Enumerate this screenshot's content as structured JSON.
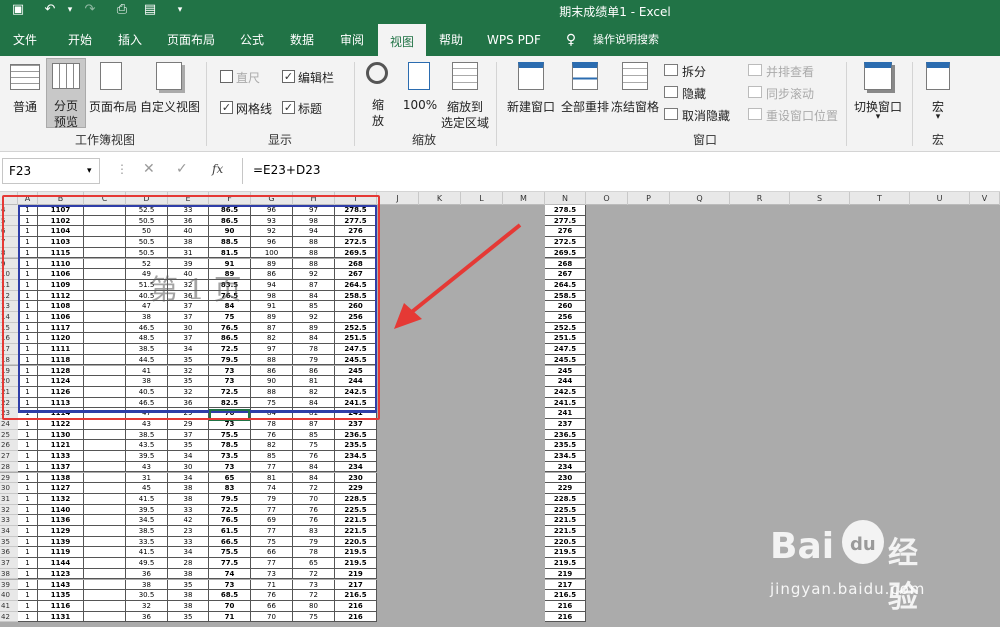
{
  "title": "期末成绩单1  -  Excel",
  "tabs": [
    "文件",
    "开始",
    "插入",
    "页面布局",
    "公式",
    "数据",
    "审阅",
    "视图",
    "帮助",
    "WPS PDF",
    "操作说明搜索"
  ],
  "active_tab": "视图",
  "ribbon": {
    "normal": "普通",
    "pagebreak1": "分页",
    "pagebreak2": "预览",
    "pagelayout": "页面布局",
    "customview": "自定义视图",
    "workbook_group": "工作簿视图",
    "ruler": "直尺",
    "formula_bar": "编辑栏",
    "gridlines": "网格线",
    "headings": "标题",
    "show_group": "显示",
    "zoom": "缩",
    "zoom2": "放",
    "zoom100": "100%",
    "zoomsel1": "缩放到",
    "zoomsel2": "选定区域",
    "zoom_group": "缩放",
    "newwin": "新建窗口",
    "arrange": "全部重排",
    "freeze": "冻结窗格",
    "split": "拆分",
    "hide": "隐藏",
    "unhide": "取消隐藏",
    "side": "并排查看",
    "sync": "同步滚动",
    "reset": "重设窗口位置",
    "window_group": "窗口",
    "switch": "切换窗口",
    "macro": "宏",
    "macro_group": "宏"
  },
  "namebox": "F23",
  "fx": "fx",
  "formula": "=E23+D23",
  "columns": [
    "A",
    "B",
    "C",
    "D",
    "E",
    "F",
    "G",
    "H",
    "I",
    "J",
    "K",
    "L",
    "M",
    "N",
    "O",
    "P",
    "Q",
    "R",
    "S",
    "T",
    "U",
    "V"
  ],
  "page_label": "第 1 页",
  "watermark": {
    "brand": "Bai",
    "paw": "du",
    "cn": "经验",
    "url": "jingyan.baidu.com"
  },
  "rows": [
    [
      "4",
      "1",
      "1107",
      "",
      "52.5",
      "33",
      "86.5",
      "96",
      "97",
      "278.5",
      "278.5"
    ],
    [
      "5",
      "1",
      "1102",
      "",
      "50.5",
      "36",
      "86.5",
      "93",
      "98",
      "277.5",
      "277.5"
    ],
    [
      "6",
      "1",
      "1104",
      "",
      "50",
      "40",
      "90",
      "92",
      "94",
      "276",
      "276"
    ],
    [
      "7",
      "1",
      "1103",
      "",
      "50.5",
      "38",
      "88.5",
      "96",
      "88",
      "272.5",
      "272.5"
    ],
    [
      "8",
      "1",
      "1115",
      "",
      "50.5",
      "31",
      "81.5",
      "100",
      "88",
      "269.5",
      "269.5"
    ],
    [
      "9",
      "1",
      "1110",
      "",
      "52",
      "39",
      "91",
      "89",
      "88",
      "268",
      "268"
    ],
    [
      "10",
      "1",
      "1106",
      "",
      "49",
      "40",
      "89",
      "86",
      "92",
      "267",
      "267"
    ],
    [
      "11",
      "1",
      "1109",
      "",
      "51.5",
      "32",
      "83.5",
      "94",
      "87",
      "264.5",
      "264.5"
    ],
    [
      "12",
      "1",
      "1112",
      "",
      "40.5",
      "36",
      "76.5",
      "98",
      "84",
      "258.5",
      "258.5"
    ],
    [
      "13",
      "1",
      "1108",
      "",
      "47",
      "37",
      "84",
      "91",
      "85",
      "260",
      "260"
    ],
    [
      "14",
      "1",
      "1106",
      "",
      "38",
      "37",
      "75",
      "89",
      "92",
      "256",
      "256"
    ],
    [
      "15",
      "1",
      "1117",
      "",
      "46.5",
      "30",
      "76.5",
      "87",
      "89",
      "252.5",
      "252.5"
    ],
    [
      "16",
      "1",
      "1120",
      "",
      "48.5",
      "37",
      "86.5",
      "82",
      "84",
      "251.5",
      "251.5"
    ],
    [
      "17",
      "1",
      "1111",
      "",
      "38.5",
      "34",
      "72.5",
      "97",
      "78",
      "247.5",
      "247.5"
    ],
    [
      "18",
      "1",
      "1118",
      "",
      "44.5",
      "35",
      "79.5",
      "88",
      "79",
      "245.5",
      "245.5"
    ],
    [
      "19",
      "1",
      "1128",
      "",
      "41",
      "32",
      "73",
      "86",
      "86",
      "245",
      "245"
    ],
    [
      "20",
      "1",
      "1124",
      "",
      "38",
      "35",
      "73",
      "90",
      "81",
      "244",
      "244"
    ],
    [
      "21",
      "1",
      "1126",
      "",
      "40.5",
      "32",
      "72.5",
      "88",
      "82",
      "242.5",
      "242.5"
    ],
    [
      "22",
      "1",
      "1113",
      "",
      "46.5",
      "36",
      "82.5",
      "75",
      "84",
      "241.5",
      "241.5"
    ],
    [
      "23",
      "1",
      "1114",
      "",
      "47",
      "29",
      "76",
      "84",
      "81",
      "241",
      "241"
    ],
    [
      "24",
      "1",
      "1122",
      "",
      "43",
      "29",
      "73",
      "78",
      "87",
      "237",
      "237"
    ],
    [
      "25",
      "1",
      "1130",
      "",
      "38.5",
      "37",
      "75.5",
      "76",
      "85",
      "236.5",
      "236.5"
    ],
    [
      "26",
      "1",
      "1121",
      "",
      "43.5",
      "35",
      "78.5",
      "82",
      "75",
      "235.5",
      "235.5"
    ],
    [
      "27",
      "1",
      "1133",
      "",
      "39.5",
      "34",
      "73.5",
      "85",
      "76",
      "234.5",
      "234.5"
    ],
    [
      "28",
      "1",
      "1137",
      "",
      "43",
      "30",
      "73",
      "77",
      "84",
      "234",
      "234"
    ],
    [
      "29",
      "1",
      "1138",
      "",
      "31",
      "34",
      "65",
      "81",
      "84",
      "230",
      "230"
    ],
    [
      "30",
      "1",
      "1127",
      "",
      "45",
      "38",
      "83",
      "74",
      "72",
      "229",
      "229"
    ],
    [
      "31",
      "1",
      "1132",
      "",
      "41.5",
      "38",
      "79.5",
      "79",
      "70",
      "228.5",
      "228.5"
    ],
    [
      "32",
      "1",
      "1140",
      "",
      "39.5",
      "33",
      "72.5",
      "77",
      "76",
      "225.5",
      "225.5"
    ],
    [
      "33",
      "1",
      "1136",
      "",
      "34.5",
      "42",
      "76.5",
      "69",
      "76",
      "221.5",
      "221.5"
    ],
    [
      "34",
      "1",
      "1129",
      "",
      "38.5",
      "23",
      "61.5",
      "77",
      "83",
      "221.5",
      "221.5"
    ],
    [
      "35",
      "1",
      "1139",
      "",
      "33.5",
      "33",
      "66.5",
      "75",
      "79",
      "220.5",
      "220.5"
    ],
    [
      "36",
      "1",
      "1119",
      "",
      "41.5",
      "34",
      "75.5",
      "66",
      "78",
      "219.5",
      "219.5"
    ],
    [
      "37",
      "1",
      "1144",
      "",
      "49.5",
      "28",
      "77.5",
      "77",
      "65",
      "219.5",
      "219.5"
    ],
    [
      "38",
      "1",
      "1123",
      "",
      "36",
      "38",
      "74",
      "73",
      "72",
      "219",
      "219"
    ],
    [
      "39",
      "1",
      "1143",
      "",
      "38",
      "35",
      "73",
      "71",
      "73",
      "217",
      "217"
    ],
    [
      "40",
      "1",
      "1135",
      "",
      "30.5",
      "38",
      "68.5",
      "76",
      "72",
      "216.5",
      "216.5"
    ],
    [
      "41",
      "1",
      "1116",
      "",
      "32",
      "38",
      "70",
      "66",
      "80",
      "216",
      "216"
    ],
    [
      "42",
      "1",
      "1131",
      "",
      "36",
      "35",
      "71",
      "70",
      "75",
      "216",
      "216"
    ]
  ]
}
